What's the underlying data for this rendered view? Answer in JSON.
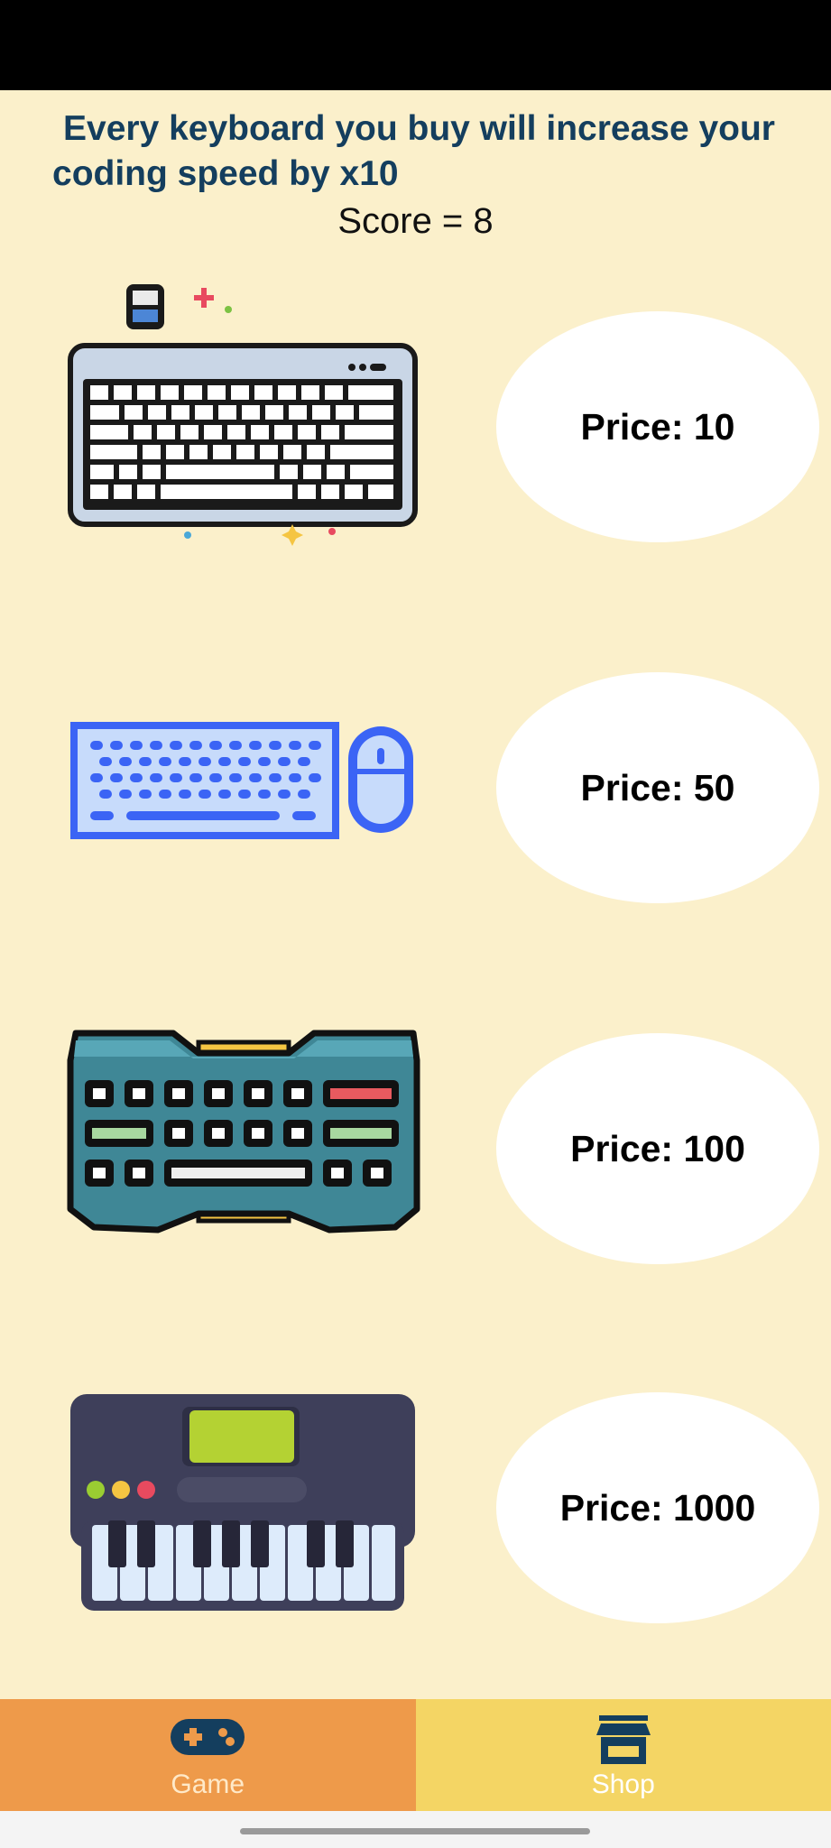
{
  "header": {
    "intro_text": "Every keyboard you buy will increase your coding speed by x10",
    "score_text": "Score = 8"
  },
  "shop": {
    "items": [
      {
        "icon": "laptop-keyboard-icon",
        "price_label": "Price: 10"
      },
      {
        "icon": "keyboard-mouse-icon",
        "price_label": "Price: 50"
      },
      {
        "icon": "mechanical-keyboard-icon",
        "price_label": "Price: 100"
      },
      {
        "icon": "piano-keyboard-icon",
        "price_label": "Price: 1000"
      }
    ]
  },
  "bottom_nav": {
    "tabs": [
      {
        "label": "Game",
        "icon": "gamepad-icon"
      },
      {
        "label": "Shop",
        "icon": "storefront-icon",
        "selected": true
      }
    ]
  },
  "colors": {
    "background": "#FBF0CB",
    "title": "#143E5E",
    "game_tab": "#EE9A4A",
    "shop_tab": "#F4D564"
  }
}
